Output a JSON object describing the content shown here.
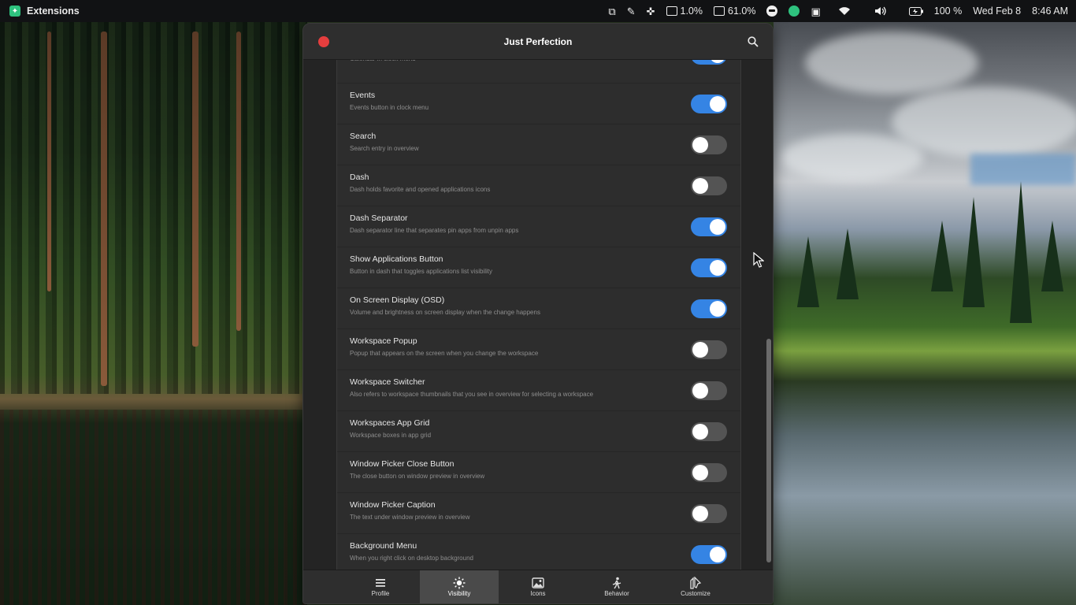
{
  "topbar": {
    "app_name": "Extensions",
    "cpu": "1.0%",
    "memory": "61.0%",
    "battery": "100 %",
    "date": "Wed Feb 8",
    "time": "8:46 AM",
    "icons": [
      "window-icon",
      "eyedropper-icon",
      "puzzle-icon",
      "cpu-icon",
      "memory-icon",
      "face-icon",
      "whatsapp-icon",
      "clipboard-icon",
      "wifi-icon",
      "volume-icon",
      "battery-icon"
    ]
  },
  "window": {
    "title": "Just Perfection"
  },
  "partial_row": {
    "subtitle": "Calendar in clock menu",
    "enabled": true
  },
  "settings": [
    {
      "title": "Events",
      "subtitle": "Events button in clock menu",
      "enabled": true
    },
    {
      "title": "Search",
      "subtitle": "Search entry in overview",
      "enabled": false
    },
    {
      "title": "Dash",
      "subtitle": "Dash holds favorite and opened applications icons",
      "enabled": false
    },
    {
      "title": "Dash Separator",
      "subtitle": "Dash separator line that separates pin apps from unpin apps",
      "enabled": true
    },
    {
      "title": "Show Applications Button",
      "subtitle": "Button in dash that toggles applications list visibility",
      "enabled": true
    },
    {
      "title": "On Screen Display (OSD)",
      "subtitle": "Volume and brightness on screen display when the change happens",
      "enabled": true
    },
    {
      "title": "Workspace Popup",
      "subtitle": "Popup that appears on the screen when you change the workspace",
      "enabled": false
    },
    {
      "title": "Workspace Switcher",
      "subtitle": "Also refers to workspace thumbnails that you see in overview for selecting a workspace",
      "enabled": false
    },
    {
      "title": "Workspaces App Grid",
      "subtitle": "Workspace boxes in app grid",
      "enabled": false
    },
    {
      "title": "Window Picker Close Button",
      "subtitle": "The close button on window preview in overview",
      "enabled": false
    },
    {
      "title": "Window Picker Caption",
      "subtitle": "The text under window preview in overview",
      "enabled": false
    },
    {
      "title": "Background Menu",
      "subtitle": "When you right click on desktop background",
      "enabled": true
    }
  ],
  "tabs": [
    {
      "label": "Profile",
      "icon": "list-icon",
      "active": false
    },
    {
      "label": "Visibility",
      "icon": "sun-icon",
      "active": true
    },
    {
      "label": "Icons",
      "icon": "image-icon",
      "active": false
    },
    {
      "label": "Behavior",
      "icon": "walk-icon",
      "active": false
    },
    {
      "label": "Customize",
      "icon": "customize-icon",
      "active": false
    }
  ],
  "colors": {
    "accent": "#3584e4",
    "close": "#e53e3e",
    "switch_off": "#545454",
    "window_bg": "#242424"
  }
}
